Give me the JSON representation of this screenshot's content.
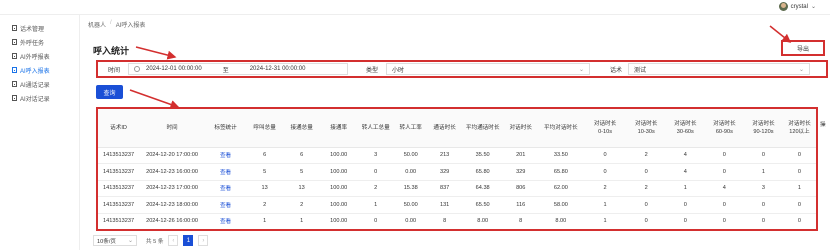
{
  "user": {
    "name": "crystal",
    "avatar_icon": "user-avatar-icon",
    "caret_icon": "chevron-down-icon"
  },
  "sidebar": {
    "items": [
      {
        "label": "话术管理",
        "active": false
      },
      {
        "label": "外呼任务",
        "active": false
      },
      {
        "label": "AI外呼报表",
        "active": false
      },
      {
        "label": "AI呼入报表",
        "active": true
      },
      {
        "label": "AI通话记录",
        "active": false
      },
      {
        "label": "AI对话记录",
        "active": false
      }
    ]
  },
  "breadcrumb": {
    "root": "机器人",
    "separator": "/",
    "current": "AI呼入报表"
  },
  "page_title": "呼入统计",
  "export_label": "导出",
  "filters": {
    "time_label": "时间",
    "start": "2024-12-01 00:00:00",
    "range_separator": "至",
    "end": "2024-12-31 00:00:00",
    "type_label": "类型",
    "type_value": "小时",
    "script_label": "话术",
    "script_value": "测试"
  },
  "query_label": "查询",
  "table": {
    "headers": [
      "话术ID",
      "时间",
      "标签统计",
      "呼叫总量",
      "接通总量",
      "接通率",
      "转人工总量",
      "转人工率",
      "通话时长",
      "平均通话时长",
      "对话时长",
      "平均对话时长",
      "对话时长\n0-10s",
      "对话时长\n10-30s",
      "对话时长\n30-60s",
      "对话时长\n60-90s",
      "对话时长\n90-120s",
      "对话时长\n120以上"
    ],
    "rows": [
      [
        "1413513237",
        "2024-12-20 17:00:00",
        "查看",
        "6",
        "6",
        "100.00",
        "3",
        "50.00",
        "213",
        "35.50",
        "201",
        "33.50",
        "0",
        "2",
        "4",
        "0",
        "0",
        "0"
      ],
      [
        "1413513237",
        "2024-12-23 16:00:00",
        "查看",
        "5",
        "5",
        "100.00",
        "0",
        "0.00",
        "329",
        "65.80",
        "329",
        "65.80",
        "0",
        "0",
        "4",
        "0",
        "1",
        "0"
      ],
      [
        "1413513237",
        "2024-12-23 17:00:00",
        "查看",
        "13",
        "13",
        "100.00",
        "2",
        "15.38",
        "837",
        "64.38",
        "806",
        "62.00",
        "2",
        "2",
        "1",
        "4",
        "3",
        "1"
      ],
      [
        "1413513237",
        "2024-12-23 18:00:00",
        "查看",
        "2",
        "2",
        "100.00",
        "1",
        "50.00",
        "131",
        "65.50",
        "116",
        "58.00",
        "1",
        "0",
        "0",
        "0",
        "0",
        "0"
      ],
      [
        "1413513237",
        "2024-12-26 16:00:00",
        "查看",
        "1",
        "1",
        "100.00",
        "0",
        "0.00",
        "8",
        "8.00",
        "8",
        "8.00",
        "1",
        "0",
        "0",
        "0",
        "0",
        "0"
      ]
    ]
  },
  "extra_col_label": "操",
  "pagination": {
    "page_size": "10条/页",
    "total": "共 5 条",
    "current_page": "1"
  },
  "colors": {
    "accent": "#1a4fd6",
    "annotation": "#d32f2f"
  }
}
